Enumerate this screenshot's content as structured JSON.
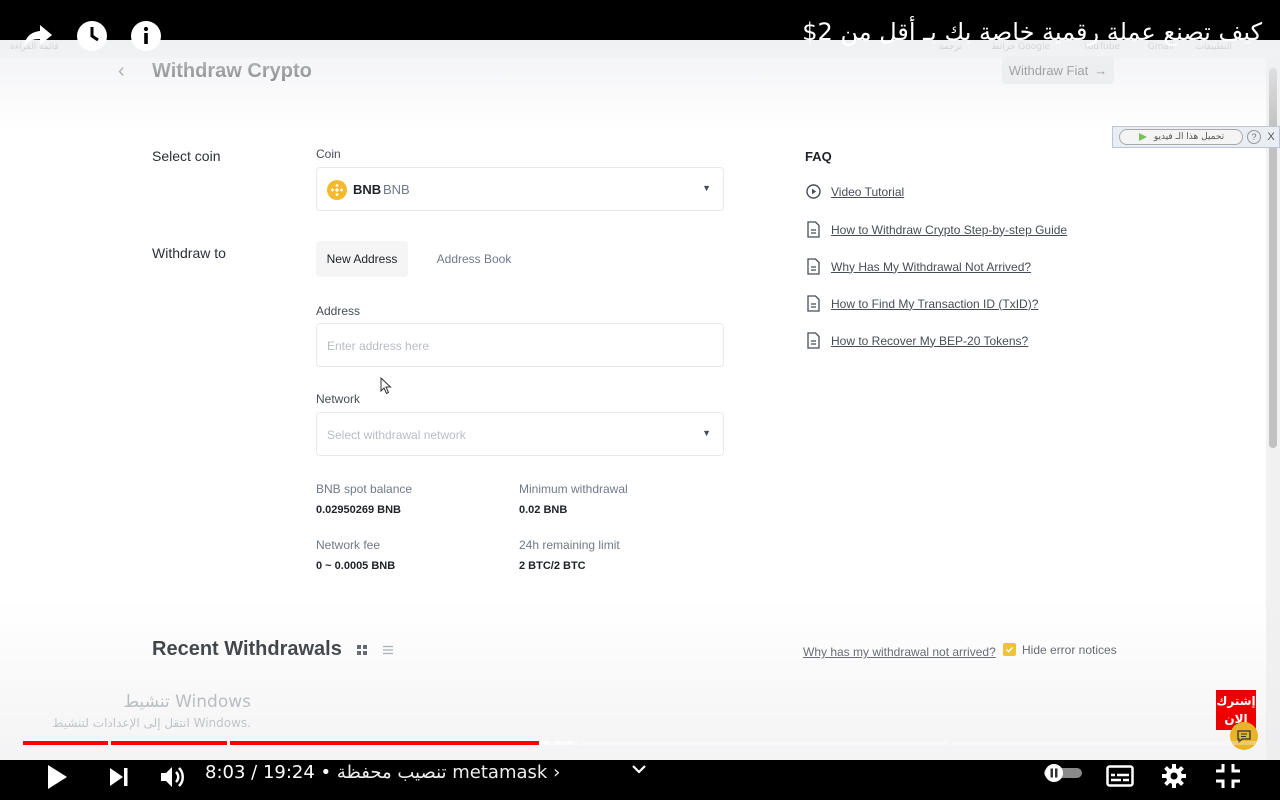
{
  "player": {
    "video_title": "كيف تصنع عملة رقمية خاصة بك بـ أقل من 2$",
    "current_time": "8:03",
    "duration": "19:24",
    "time_separator": " / ",
    "chapter_separator": " • ",
    "chapter": "تنصيب محفظة metamask",
    "chapter_arrow": "›",
    "progress_fraction": 0.418,
    "buffered_fraction": 0.446,
    "subscribe_line1": "إشترك",
    "subscribe_line2": "الان"
  },
  "bookmarks": {
    "items": [
      "التطبيقات",
      "Gmail",
      "YouTube",
      "خرائط Google",
      "ترجمة",
      "قائمة القراءة"
    ]
  },
  "download_bar": {
    "label": "تحميل هذا الـ فيديو",
    "help": "?",
    "close": "X"
  },
  "windows_watermark": {
    "title": "تنشيط Windows",
    "subtitle": "انتقل إلى الإعدادات لتنشيط Windows."
  },
  "header": {
    "back": "‹",
    "title": "Withdraw Crypto",
    "withdraw_fiat": "Withdraw Fiat",
    "withdraw_fiat_arrow": "→"
  },
  "form": {
    "select_coin_label": "Select coin",
    "coin_field_label": "Coin",
    "coin_symbol": "BNB",
    "coin_name": "BNB",
    "withdraw_to_label": "Withdraw to",
    "tab_new_address": "New Address",
    "tab_address_book": "Address Book",
    "address_label": "Address",
    "address_placeholder": "Enter address here",
    "network_label": "Network",
    "network_placeholder": "Select withdrawal network"
  },
  "stats": {
    "spot_balance_label": "BNB spot balance",
    "spot_balance_value": "0.02950269 BNB",
    "min_withdrawal_label": "Minimum withdrawal",
    "min_withdrawal_value": "0.02 BNB",
    "network_fee_label": "Network fee",
    "network_fee_value": "0 ~ 0.0005 BNB",
    "limit_label": "24h remaining limit",
    "limit_value": "2 BTC/2 BTC"
  },
  "faq": {
    "title": "FAQ",
    "items": [
      {
        "label": "Video Tutorial",
        "icon": "play-circle-icon"
      },
      {
        "label": "How to Withdraw Crypto Step-by-step Guide",
        "icon": "document-icon"
      },
      {
        "label": "Why Has My Withdrawal Not Arrived?",
        "icon": "document-icon"
      },
      {
        "label": "How to Find My Transaction ID (TxID)?",
        "icon": "document-icon"
      },
      {
        "label": "How to Recover My BEP-20 Tokens?",
        "icon": "document-icon"
      }
    ]
  },
  "recent": {
    "title": "Recent Withdrawals",
    "why_link": "Why has my withdrawal not arrived?",
    "hide_errors_label": "Hide error notices",
    "hide_errors_checked": true
  },
  "colors": {
    "accent": "#f0b90b",
    "progress": "#ff0000",
    "subscribe": "#ee0000"
  }
}
